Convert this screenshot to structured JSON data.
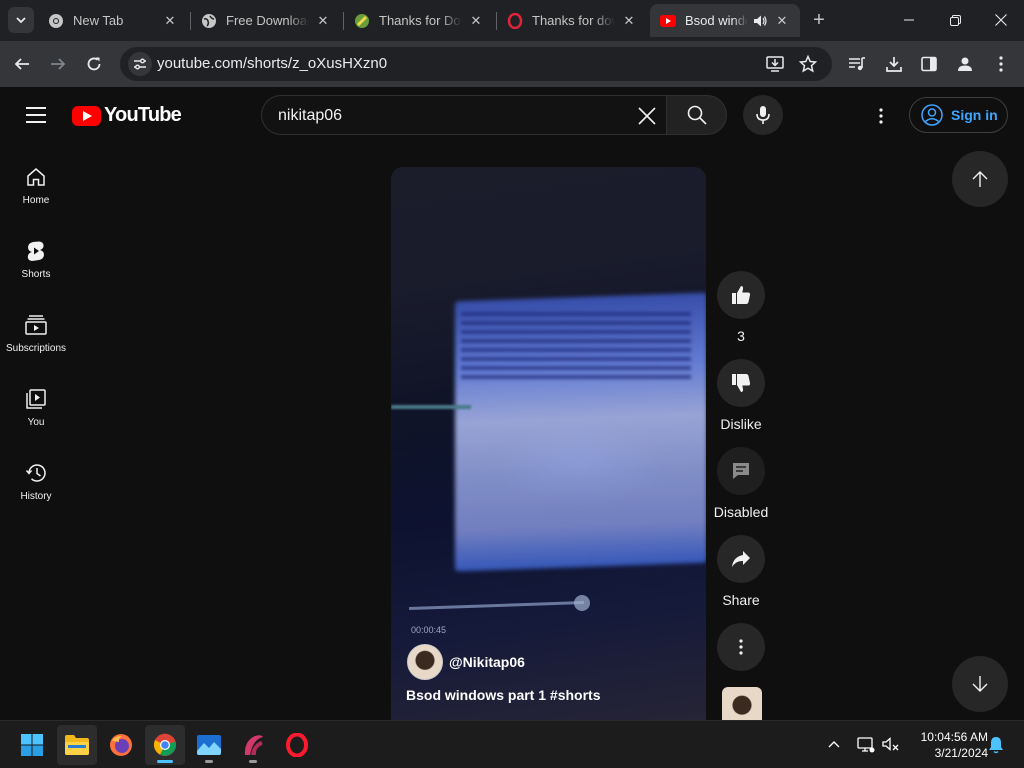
{
  "browser": {
    "tabs": [
      {
        "label": "New Tab",
        "favicon": "chrome-icon",
        "active": false
      },
      {
        "label": "Free Download",
        "favicon": "globe-icon",
        "active": false
      },
      {
        "label": "Thanks for Dow",
        "favicon": "site-icon",
        "active": false
      },
      {
        "label": "Thanks for dow",
        "favicon": "opera-icon",
        "active": false
      },
      {
        "label": "Bsod windo",
        "favicon": "youtube-icon",
        "active": true,
        "audio": true
      }
    ],
    "url": "youtube.com/shorts/z_oXusHXzn0"
  },
  "youtube": {
    "logo_text": "YouTube",
    "search_value": "nikitap06",
    "signin_label": "Sign in",
    "guide": [
      {
        "label": "Home",
        "icon": "home-icon"
      },
      {
        "label": "Shorts",
        "icon": "shorts-icon"
      },
      {
        "label": "Subscriptions",
        "icon": "subscriptions-icon"
      },
      {
        "label": "You",
        "icon": "you-icon"
      },
      {
        "label": "History",
        "icon": "history-icon"
      }
    ],
    "short": {
      "video_timestamp": "00:00:45",
      "channel_handle": "@Nikitap06",
      "title": "Bsod windows part 1 #shorts"
    },
    "actions": {
      "like_count": "3",
      "dislike_label": "Dislike",
      "comments_label": "Disabled",
      "share_label": "Share"
    }
  },
  "taskbar": {
    "apps": [
      "start-icon",
      "file-explorer-icon",
      "firefox-icon",
      "chrome-icon",
      "photos-icon",
      "app-icon",
      "opera-icon"
    ],
    "time": "10:04:56 AM",
    "date": "3/21/2024"
  },
  "colors": {
    "yt_red": "#ff0000",
    "signin_blue": "#3ea6ff",
    "bg": "#0f0f0f"
  }
}
